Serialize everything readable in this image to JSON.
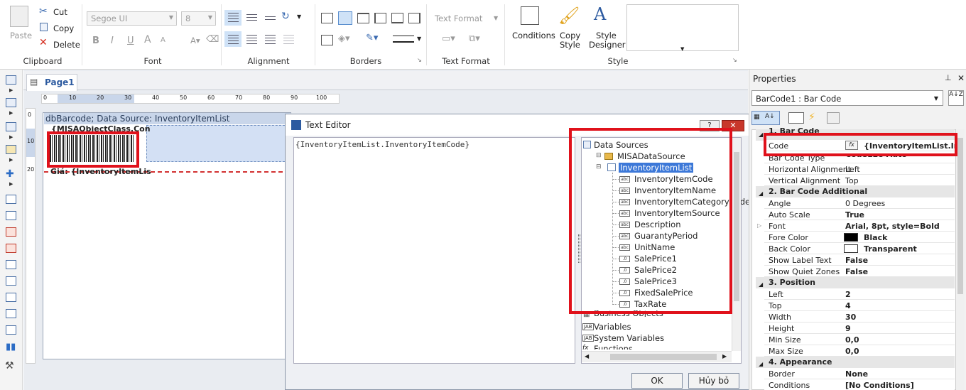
{
  "ribbon": {
    "clipboard": {
      "paste": "Paste",
      "cut": "Cut",
      "copy": "Copy",
      "delete": "Delete",
      "group": "Clipboard"
    },
    "font": {
      "family": "Segoe UI",
      "size": "8",
      "group": "Font",
      "bold": "B",
      "italic": "I",
      "underline": "U",
      "grow": "A",
      "shrink": "A"
    },
    "alignment": {
      "group": "Alignment"
    },
    "borders": {
      "group": "Borders"
    },
    "text_format": {
      "label": "Text Format",
      "group": "Text Format"
    },
    "style": {
      "conditions": "Conditions",
      "copy_style_1": "Copy",
      "copy_style_2": "Style",
      "designer_1": "Style",
      "designer_2": "Designer",
      "group": "Style"
    }
  },
  "tabs": {
    "page1": "Page1"
  },
  "ruler": [
    "0",
    "10",
    "20",
    "30",
    "40",
    "50",
    "60",
    "70",
    "80",
    "90",
    "100"
  ],
  "vruler": [
    "0",
    "10",
    "20"
  ],
  "report": {
    "band_title": "dbBarcode; Data Source: InventoryItemList",
    "class_field": "{MISAObjectClass.Con",
    "price_label": "Giá: {InventoryItemLis"
  },
  "dialog": {
    "title": "Text Editor",
    "expression": "{InventoryItemList.InventoryItemCode}",
    "ok": "OK",
    "cancel": "Hủy bỏ",
    "tree": {
      "root": "Data Sources",
      "source": "MISADataSource",
      "list": "InventoryItemList",
      "fields": [
        "InventoryItemCode",
        "InventoryItemName",
        "InventoryItemCategoryCode",
        "InventoryItemSource",
        "Description",
        "GuarantyPeriod",
        "UnitName",
        "SalePrice1",
        "SalePrice2",
        "SalePrice3",
        "FixedSalePrice",
        "TaxRate"
      ],
      "field_types": [
        "abc",
        "abc",
        "abc",
        "abc",
        "abc",
        "abc",
        "abc",
        ".0",
        ".0",
        ".0",
        ".0",
        ".0"
      ],
      "business": "Business Objects",
      "variables": "Variables",
      "system_variables": "System Variables",
      "functions": "Functions"
    }
  },
  "properties": {
    "title": "Properties",
    "selector": "BarCode1 : Bar Code",
    "cat1": "1. Bar  Code",
    "code_name": "Code",
    "code_value": "{InventoryItemList.Inve",
    "rows1": [
      {
        "name": "Bar Code Type",
        "value": "Code128 Auto",
        "bold": true
      },
      {
        "name": "Horizontal Alignment",
        "value": "Left",
        "bold": false
      },
      {
        "name": "Vertical Alignment",
        "value": "Top",
        "bold": false
      }
    ],
    "cat2": "2. Bar  Code  Additional",
    "rows2": [
      {
        "name": "Angle",
        "value": "0 Degrees",
        "bold": false
      },
      {
        "name": "Auto Scale",
        "value": "True",
        "bold": true
      },
      {
        "name": "Font",
        "value": "Arial, 8pt, style=Bold",
        "bold": true
      },
      {
        "name": "Fore Color",
        "value": "Black",
        "bold": true
      },
      {
        "name": "Back Color",
        "value": "Transparent",
        "bold": true
      },
      {
        "name": "Show Label Text",
        "value": "False",
        "bold": true
      },
      {
        "name": "Show Quiet Zones",
        "value": "False",
        "bold": true
      }
    ],
    "cat3": "3. Position",
    "rows3": [
      {
        "name": "Left",
        "value": "2",
        "bold": true
      },
      {
        "name": "Top",
        "value": "4",
        "bold": true
      },
      {
        "name": "Width",
        "value": "30",
        "bold": true
      },
      {
        "name": "Height",
        "value": "9",
        "bold": true
      },
      {
        "name": "Min Size",
        "value": "0,0",
        "bold": true
      },
      {
        "name": "Max Size",
        "value": "0,0",
        "bold": true
      }
    ],
    "cat4": "4. Appearance",
    "rows4": [
      {
        "name": "Border",
        "value": "None",
        "bold": true
      },
      {
        "name": "Conditions",
        "value": "[No Conditions]",
        "bold": true
      }
    ]
  },
  "colors": {
    "accent": "#3c78c8",
    "highlight": "#e0111b",
    "selected": "#3c78d8"
  }
}
